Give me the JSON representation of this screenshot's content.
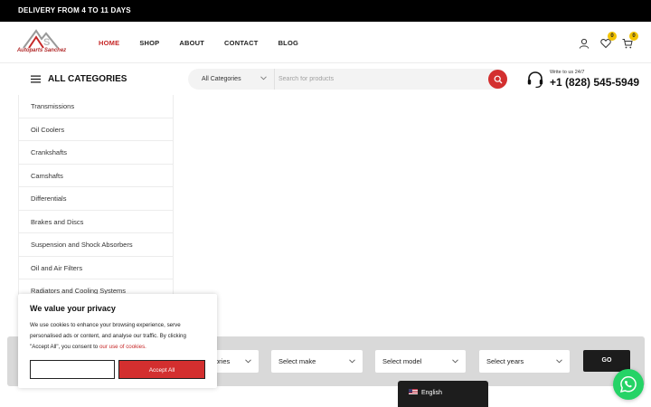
{
  "topbar": {
    "text": "DELIVERY FROM 4 TO 11 DAYS"
  },
  "logo": {
    "name": "Autoparts Sanchez"
  },
  "nav": [
    {
      "label": "HOME",
      "active": true
    },
    {
      "label": "SHOP"
    },
    {
      "label": "ABOUT"
    },
    {
      "label": "CONTACT"
    },
    {
      "label": "BLOG"
    }
  ],
  "header_icons": {
    "wishlist_count": "0",
    "cart_count": "0"
  },
  "categories_bar": {
    "label": "ALL CATEGORIES"
  },
  "search": {
    "category": "All Categories",
    "placeholder": "Search for products"
  },
  "support": {
    "small": "Write to us 24/7",
    "phone": "+1 (828) 545-5949"
  },
  "category_menu": [
    "Transmissions",
    "Oil Coolers",
    "Crankshafts",
    "Camshafts",
    "Differentials",
    "Brakes and Discs",
    "Suspension and Shock Absorbers",
    "Oil and Air Filters",
    "Radiators and Cooling Systems"
  ],
  "finder": {
    "first_select_visible": "ories",
    "make": "Select make",
    "model": "Select model",
    "years": "Select years",
    "go": "GO"
  },
  "cookie": {
    "title": "We value your privacy",
    "text_1": "We use cookies to enhance your browsing experience, serve personalised ads or content, and analyse our traffic. By clicking \"Accept All\", you consent to ",
    "link": "our use of cookies.",
    "accept": "Accept All"
  },
  "language": {
    "label": "English"
  },
  "colors": {
    "accent": "#d32f2f",
    "badge": "#f2c300",
    "whatsapp": "#25d366"
  }
}
